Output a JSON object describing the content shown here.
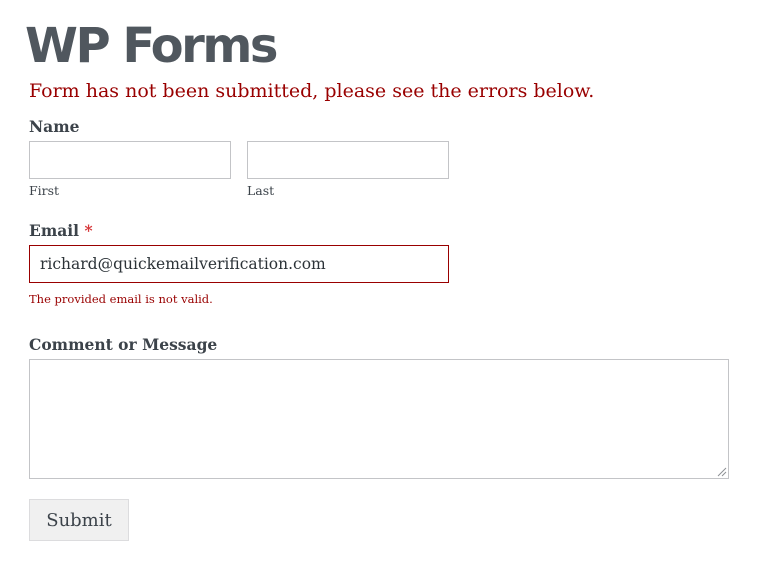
{
  "page": {
    "title": "WP Forms"
  },
  "form": {
    "error_message": "Form has not been submitted, please see the errors below.",
    "name": {
      "label": "Name",
      "first": {
        "value": "",
        "sublabel": "First"
      },
      "last": {
        "value": "",
        "sublabel": "Last"
      }
    },
    "email": {
      "label": "Email",
      "required_marker": "*",
      "value": "richard@quickemailverification.com",
      "error": "The provided email is not valid."
    },
    "message": {
      "label": "Comment or Message",
      "value": ""
    },
    "submit_label": "Submit"
  },
  "colors": {
    "error": "#990000",
    "required": "#d63638",
    "title": "#50575e",
    "border": "#c3c4c7",
    "button_bg": "#f0f0f0"
  }
}
